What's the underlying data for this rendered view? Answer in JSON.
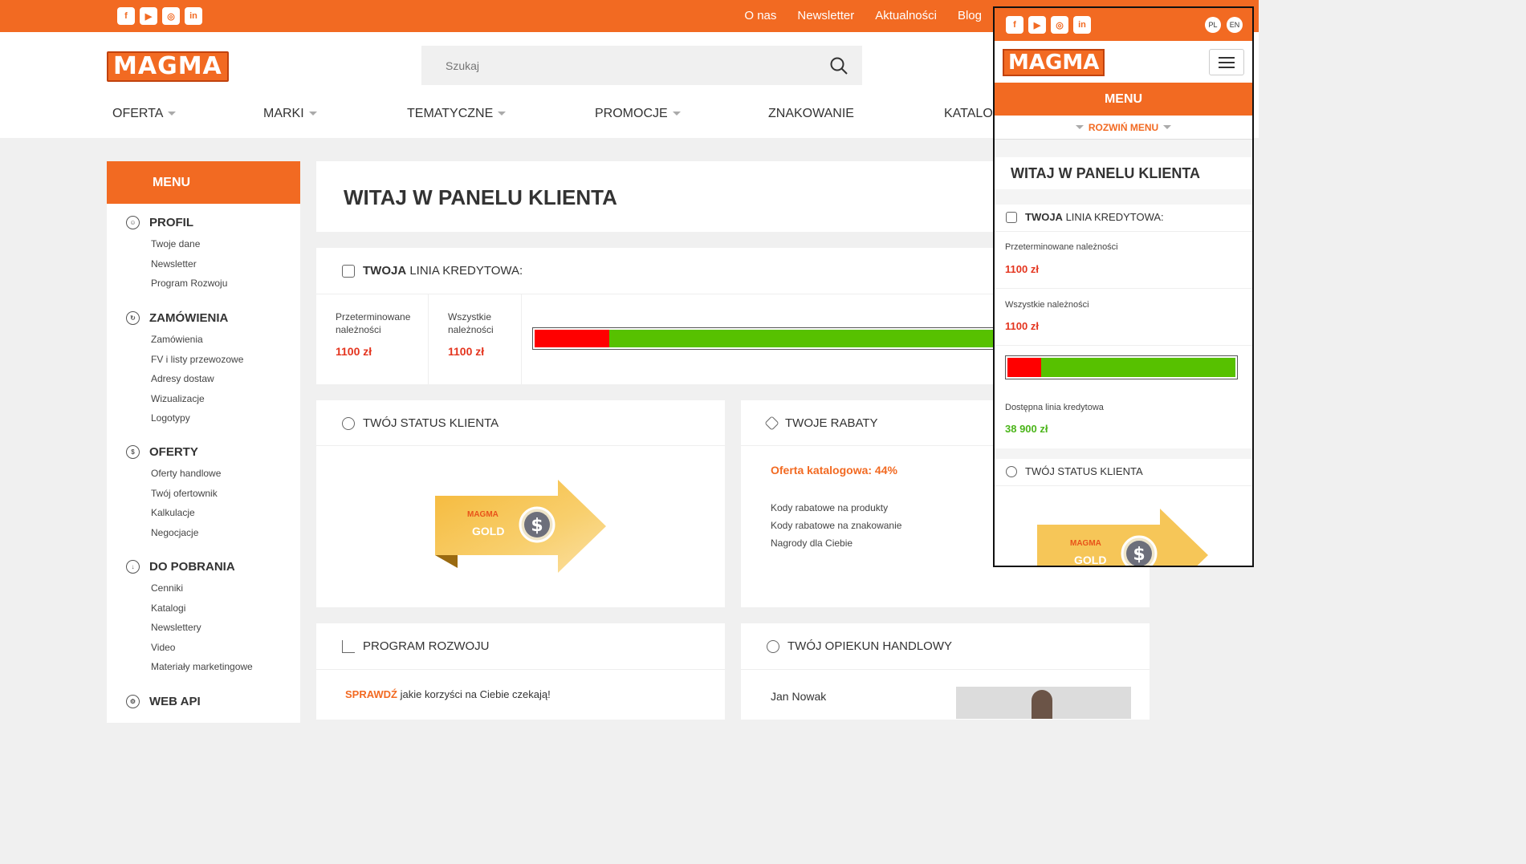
{
  "top": {
    "links": [
      "O nas",
      "Newsletter",
      "Aktualności",
      "Blog"
    ],
    "social": [
      "f",
      "▶",
      "◎",
      "in"
    ]
  },
  "logo_text": "MAGMA",
  "search": {
    "placeholder": "Szukaj"
  },
  "nav": [
    "OFERTA",
    "MARKI",
    "TEMATYCZNE",
    "PROMOCJE",
    "ZNAKOWANIE",
    "KATALO"
  ],
  "sidebar": {
    "header": "MENU",
    "sections": [
      {
        "title": "PROFIL",
        "items": [
          "Twoje dane",
          "Newsletter",
          "Program Rozwoju"
        ]
      },
      {
        "title": "ZAMÓWIENIA",
        "items": [
          "Zamówienia",
          "FV i listy przewozowe",
          "Adresy dostaw",
          "Wizualizacje",
          "Logotypy"
        ]
      },
      {
        "title": "OFERTY",
        "items": [
          "Oferty handlowe",
          "Twój ofertownik",
          "Kalkulacje",
          "Negocjacje"
        ]
      },
      {
        "title": "DO POBRANIA",
        "items": [
          "Cenniki",
          "Katalogi",
          "Newslettery",
          "Video",
          "Materiały marketingowe"
        ]
      },
      {
        "title": "WEB API",
        "items": []
      }
    ]
  },
  "welcome": {
    "title": "WITAJ W PANELU KLIENTA"
  },
  "credit": {
    "title_bold": "TWOJA",
    "title_rest": " LINIA KREDYTOWA:",
    "overdue_label": "Przeterminowane należności",
    "overdue_value": "1100 zł",
    "all_label": "Wszystkie należności",
    "all_value": "1100 zł",
    "available_label": "Dostępna linia kredytowa",
    "available_value": "38 900 zł",
    "used_fraction": 0.15
  },
  "status": {
    "title": "TWÓJ STATUS KLIENTA",
    "badge": "GOLD",
    "badge_logo": "MAGMA"
  },
  "discounts": {
    "title": "TWOJE RABATY",
    "catalog": "Oferta katalogowa: 44%",
    "items": [
      "Kody rabatowe na produkty",
      "Kody rabatowe na znakowanie",
      "Nagrody dla Ciebie"
    ]
  },
  "program": {
    "title": "PROGRAM ROZWOJU",
    "cta": "SPRAWDŹ",
    "cta_rest": " jakie korzyści na Ciebie czekają!"
  },
  "advisor": {
    "title": "TWÓJ OPIEKUN HANDLOWY",
    "name": "Jan Nowak"
  },
  "mobile": {
    "langs": [
      "PL",
      "EN"
    ],
    "menu": "MENU",
    "expand": "ROZWIŃ MENU"
  }
}
